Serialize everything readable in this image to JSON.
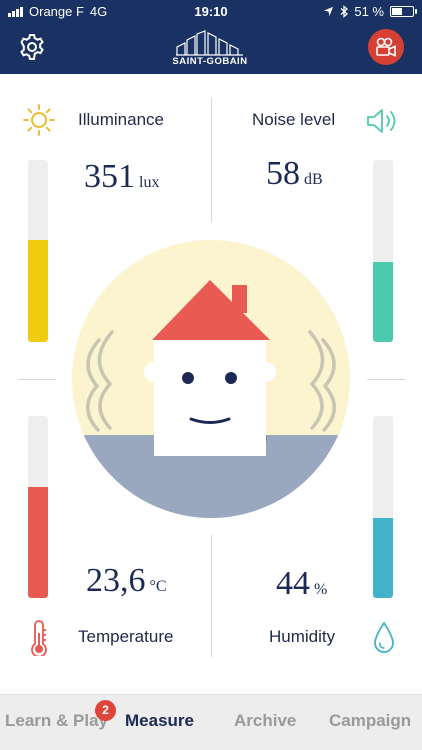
{
  "status_bar": {
    "carrier": "Orange F",
    "network": "4G",
    "time": "19:10",
    "battery": "51 %",
    "battery_level": 0.51
  },
  "header": {
    "logo_text": "SAINT-GOBAIN",
    "left_icon": "gear-icon",
    "right_icon": "camera-icon"
  },
  "sensors": {
    "illuminance": {
      "label": "Illuminance",
      "value": "351",
      "unit": "lux",
      "level": 0.56,
      "color": "#f0cc0e",
      "icon": "sun-icon"
    },
    "noise": {
      "label": "Noise level",
      "value": "58",
      "unit": "dB",
      "level": 0.44,
      "color": "#4ccaae",
      "icon": "speaker-icon"
    },
    "temperature": {
      "label": "Temperature",
      "value": "23,6",
      "unit": "°C",
      "level": 0.61,
      "color": "#e85a52",
      "icon": "thermometer-icon"
    },
    "humidity": {
      "label": "Humidity",
      "value": "44",
      "unit": "%",
      "level": 0.44,
      "color": "#41b2c9",
      "icon": "drop-icon"
    }
  },
  "tabs": [
    {
      "label": "Learn & Play",
      "active": false,
      "badge": "2"
    },
    {
      "label": "Measure",
      "active": true
    },
    {
      "label": "Archive",
      "active": false
    },
    {
      "label": "Campaign",
      "active": false
    }
  ]
}
